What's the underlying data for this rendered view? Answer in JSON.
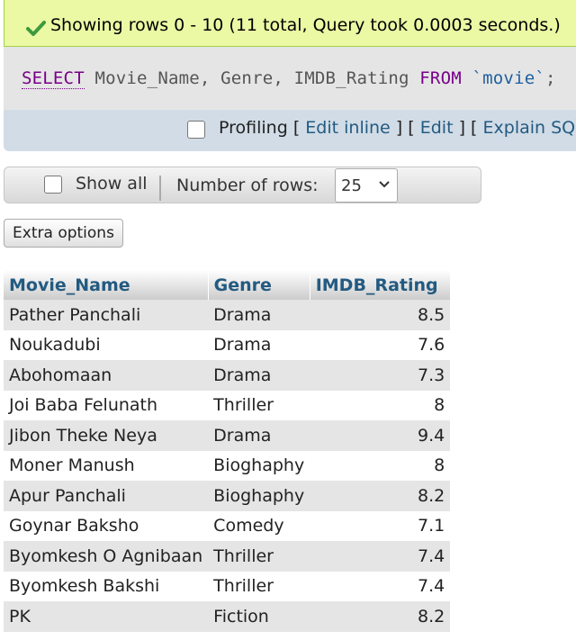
{
  "success": {
    "message": "Showing rows 0 - 10 (11 total, Query took 0.0003 seconds.)"
  },
  "sql": {
    "select_kw": "SELECT",
    "columns": "Movie_Name, Genre, IMDB_Rating",
    "from_kw": "FROM",
    "table": "`movie`",
    "end": ";"
  },
  "tools": {
    "profiling": "Profiling",
    "open1": "[",
    "edit_inline": "Edit inline",
    "close1": "]",
    "open2": "[",
    "edit": "Edit",
    "close2": "]",
    "open3": "[",
    "explain_sql": "Explain SQL",
    "close3": "]"
  },
  "nav": {
    "show_all": "Show all",
    "number_of_rows": "Number of rows:",
    "rows_value": "25"
  },
  "extra_options": "Extra options",
  "table": {
    "headers": [
      "Movie_Name",
      "Genre",
      "IMDB_Rating"
    ],
    "rows": [
      [
        "Pather Panchali",
        "Drama",
        "8.5"
      ],
      [
        "Noukadubi",
        "Drama",
        "7.6"
      ],
      [
        "Abohomaan",
        "Drama",
        "7.3"
      ],
      [
        "Joi Baba Felunath",
        "Thriller",
        "8"
      ],
      [
        "Jibon Theke Neya",
        "Drama",
        "9.4"
      ],
      [
        "Moner Manush",
        "Bioghaphy",
        "8"
      ],
      [
        "Apur Panchali",
        "Bioghaphy",
        "8.2"
      ],
      [
        "Goynar Baksho",
        "Comedy",
        "7.1"
      ],
      [
        "Byomkesh O Agnibaan",
        "Thriller",
        "7.4"
      ],
      [
        "Byomkesh Bakshi",
        "Thriller",
        "7.4"
      ],
      [
        "PK",
        "Fiction",
        "8.2"
      ]
    ]
  }
}
